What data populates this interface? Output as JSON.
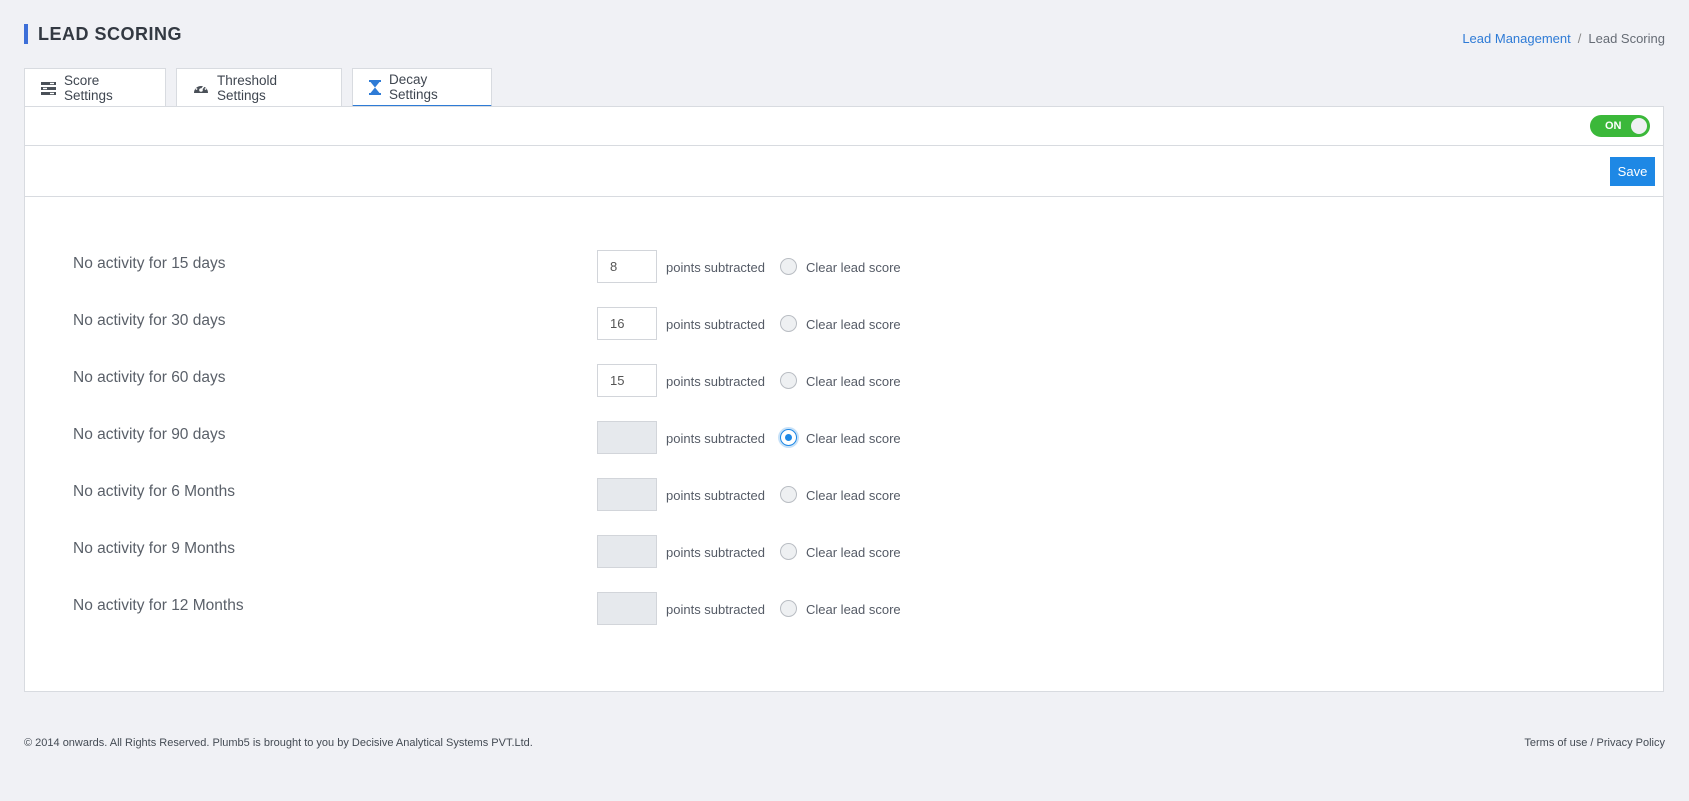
{
  "header": {
    "title": "LEAD SCORING",
    "breadcrumb": {
      "parent": "Lead Management",
      "separator": "/",
      "current": "Lead Scoring"
    }
  },
  "tabs": [
    {
      "label": "Score Settings",
      "icon": "list-settings-icon",
      "active": false
    },
    {
      "label": "Threshold Settings",
      "icon": "speedometer-icon",
      "active": false
    },
    {
      "label": "Decay Settings",
      "icon": "hourglass-icon",
      "active": true
    }
  ],
  "toggle": {
    "label": "ON",
    "state": "on",
    "color": "#3bb83a"
  },
  "toolbar": {
    "save_label": "Save"
  },
  "rules": [
    {
      "label": "No activity for 15 days",
      "points": "8",
      "points_text": "points subtracted",
      "clear_label": "Clear lead score",
      "clear_selected": false
    },
    {
      "label": "No activity for 30 days",
      "points": "16",
      "points_text": "points subtracted",
      "clear_label": "Clear lead score",
      "clear_selected": false
    },
    {
      "label": "No activity for 60 days",
      "points": "15",
      "points_text": "points subtracted",
      "clear_label": "Clear lead score",
      "clear_selected": false
    },
    {
      "label": "No activity for 90 days",
      "points": "",
      "points_text": "points subtracted",
      "clear_label": "Clear lead score",
      "clear_selected": true
    },
    {
      "label": "No activity for 6 Months",
      "points": "",
      "points_text": "points subtracted",
      "clear_label": "Clear lead score",
      "clear_selected": false
    },
    {
      "label": "No activity for 9 Months",
      "points": "",
      "points_text": "points subtracted",
      "clear_label": "Clear lead score",
      "clear_selected": false
    },
    {
      "label": "No activity for 12 Months",
      "points": "",
      "points_text": "points subtracted",
      "clear_label": "Clear lead score",
      "clear_selected": false
    }
  ],
  "footer": {
    "copyright": "© 2014 onwards. All Rights Reserved. Plumb5 is brought to you by Decisive Analytical Systems PVT.Ltd.",
    "terms": "Terms of use",
    "separator": "/",
    "privacy": "Privacy Policy"
  },
  "colors": {
    "accent": "#1e88e5",
    "title_bar": "#3d6fd8",
    "toggle_on": "#3bb83a"
  }
}
